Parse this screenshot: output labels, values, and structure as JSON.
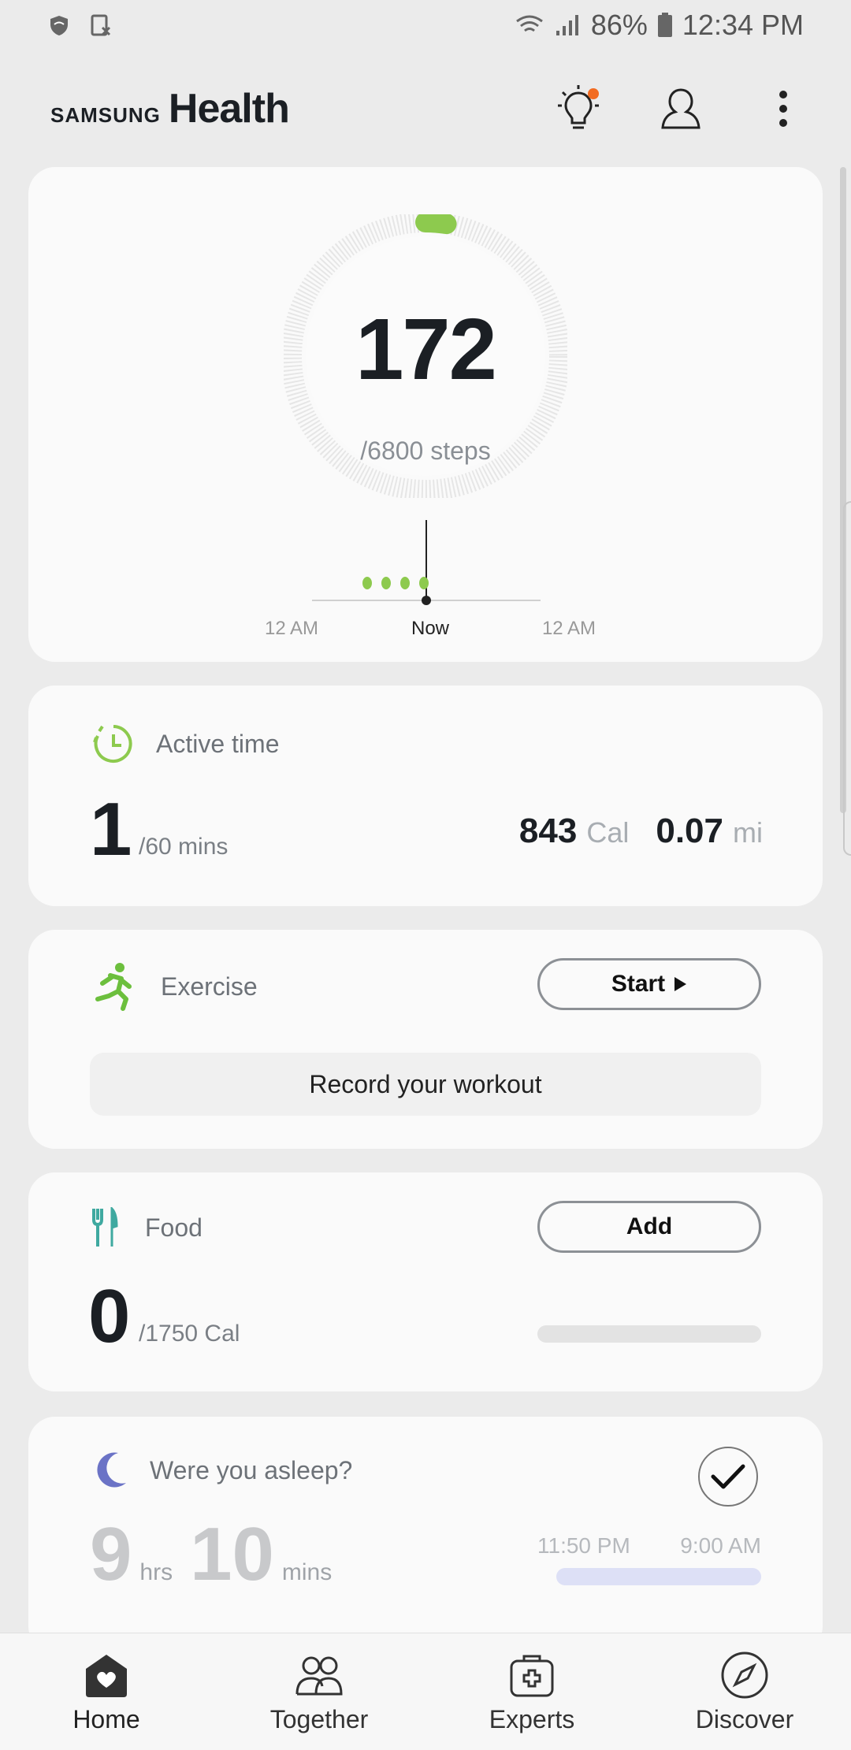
{
  "status": {
    "battery": "86%",
    "time": "12:34 PM"
  },
  "header": {
    "brand_samsung": "SAMSUNG",
    "brand_health": "Health"
  },
  "steps": {
    "count": "172",
    "goal": "/6800 steps",
    "progress_fraction": 0.025,
    "timeline_labels": [
      "12 AM",
      "Now",
      "12 AM"
    ]
  },
  "active_time": {
    "title": "Active time",
    "value": "1",
    "unit": "/60 mins",
    "calories": "843",
    "calories_unit": "Cal",
    "distance": "0.07",
    "distance_unit": "mi"
  },
  "exercise": {
    "title": "Exercise",
    "start_label": "Start",
    "record_label": "Record your workout"
  },
  "food": {
    "title": "Food",
    "add_label": "Add",
    "value": "0",
    "unit": "/1750 Cal",
    "progress_fraction": 0
  },
  "sleep": {
    "title": "Were you asleep?",
    "hours": "9",
    "hours_unit": "hrs",
    "minutes": "10",
    "minutes_unit": "mins",
    "start_time": "11:50 PM",
    "end_time": "9:00 AM"
  },
  "nav": {
    "home": "Home",
    "together": "Together",
    "experts": "Experts",
    "discover": "Discover"
  },
  "colors": {
    "accent_green": "#78b84a",
    "badge_orange": "#f26b21",
    "sleep_purple": "#6b73c6",
    "food_teal": "#3fa9a0"
  }
}
